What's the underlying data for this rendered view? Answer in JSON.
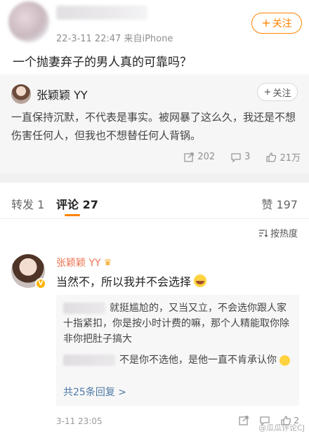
{
  "post": {
    "meta": "22-3-11 22:47  来自iPhone",
    "follow_label": "关注",
    "text": "一个抛妻弃子的男人真的可靠吗？"
  },
  "repost": {
    "author": "张颖颖 YY",
    "follow_label": "关注",
    "text": "一直保持沉默，不代表是事实。被网暴了这么久，我还是不想伤害任何人，但我也不想替任何人背锅。",
    "repost_count": "202",
    "comment_count": "3",
    "like_count": "21万"
  },
  "tabs": {
    "repost": "转发 1",
    "comment": "评论 27",
    "like": "赞 197"
  },
  "sort_label": "按热度",
  "comment": {
    "author": "张颖颖 YY",
    "text": "当然不，所以我并不会选择",
    "replies": [
      {
        "text": "就挺尴尬的，又当又立，不会选你跟人家十指紧扣，你是按小时计费的嘛，那个人精能取你除非你把肚子搞大"
      },
      {
        "text": "不是你不选他，是他一直不肯承认你"
      }
    ],
    "more_replies": "共25条回复 >",
    "time": "3-11 23:05",
    "like_count": "2"
  },
  "watermark": "@瓜瓜评论CJ"
}
